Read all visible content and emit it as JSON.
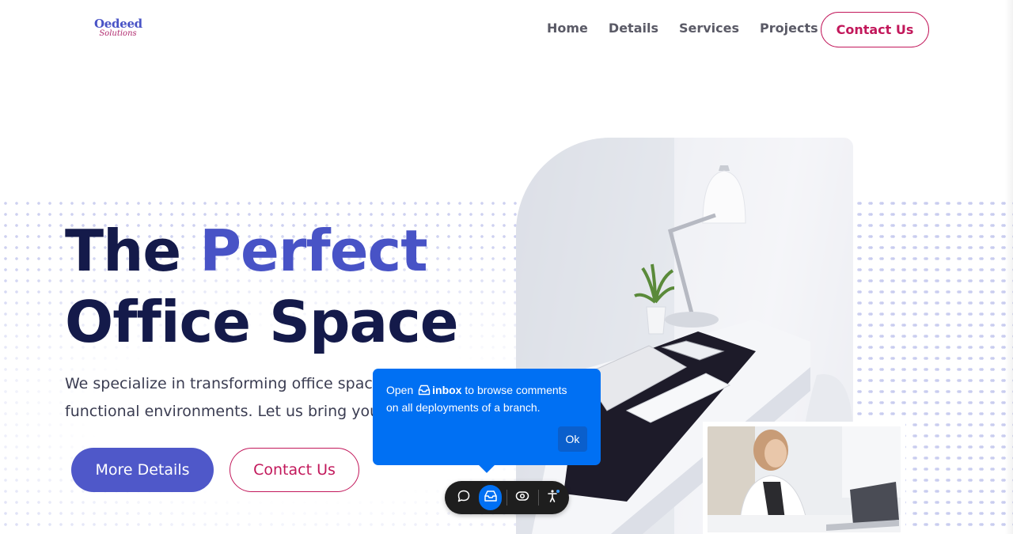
{
  "header": {
    "logo_line1": "Oedeed",
    "logo_line2": "Solutions",
    "nav": [
      "Home",
      "Details",
      "Services",
      "Projects"
    ],
    "cta_label": "Contact Us"
  },
  "hero": {
    "title_word1": "The",
    "title_word2": "Perfect",
    "title_line2": "Office Space",
    "subtitle_line1": "We specialize in transforming office spaces",
    "subtitle_line2": "functional environments. Let us bring your v",
    "primary_button": "More Details",
    "secondary_button": "Contact Us"
  },
  "tooltip": {
    "text_open": "Open",
    "inbox_word": "inbox",
    "text_rest_line1": "to browse comments",
    "text_line2": "on all deployments of a branch.",
    "ok_label": "Ok"
  },
  "toolbar": {
    "icons": [
      "comment-icon",
      "inbox-icon",
      "eye-icon",
      "accessibility-icon"
    ],
    "active": "inbox-icon"
  },
  "colors": {
    "brand": "#4853c6",
    "accent": "#c2185b",
    "heading": "#141a4a",
    "tooltip": "#0070f3"
  }
}
